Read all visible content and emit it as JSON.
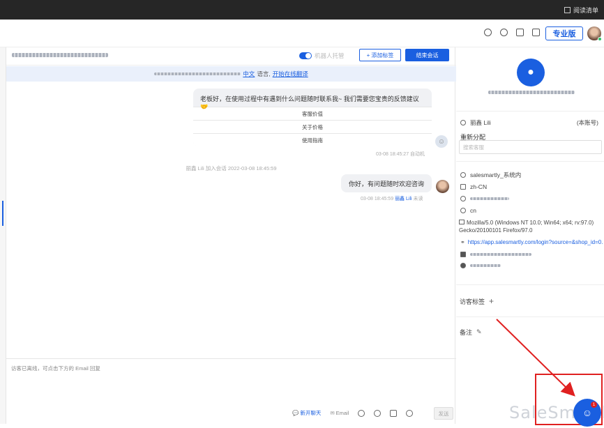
{
  "browser": {
    "reading_list": "阅读清单"
  },
  "header": {
    "pro_label": "专业版"
  },
  "chat": {
    "robot_label": "机器人托管",
    "tag_button": "添加标签",
    "end_button": "结束会话",
    "lang_bar": {
      "mid": "中文",
      "after": "语言,",
      "link": "开始在线翻译"
    },
    "bot_message": "老板好，在使用过程中有遇到什么问题随时联系我~ 我们需要您宝贵的反馈建议🤝",
    "options": [
      "客服价值",
      "关于价格",
      "使用指南"
    ],
    "bot_meta": "03-08 18:45:27 自动机",
    "system_line": "丽鑫 Lili 加入会话 2022-03-08 18:45:59",
    "agent_message": "你好，有问题随时欢迎咨询",
    "agent_meta_time": "03-08 18:45:59",
    "agent_meta_name": "丽鑫 Lili",
    "agent_meta_status": "未读",
    "input_hint": "访客已离线，可点击下方的 Email 回复",
    "tools": {
      "new_chat": "新开聊天",
      "email": "Email",
      "send": "发送"
    }
  },
  "side": {
    "agent": "丽鑫 Lili",
    "account": "(本账号)",
    "reassign": "重新分配",
    "select_placeholder": "搜索客服",
    "source": "salesmartly_系统内",
    "lang": "zh-CN",
    "country": "cn",
    "ua": "Mozilla/5.0 (Windows NT 10.0; Win64; x64; rv:97.0) Gecko/20100101 Firefox/97.0",
    "url": "https://app.salesmartly.com/login?source=&shop_id=0...",
    "visitor_tag": "访客标签",
    "note": "备注"
  },
  "watermark": "SaleSmartly",
  "fab": {
    "badge": "1"
  },
  "colors": {
    "accent": "#1a5fe0",
    "annotation": "#e02020"
  }
}
